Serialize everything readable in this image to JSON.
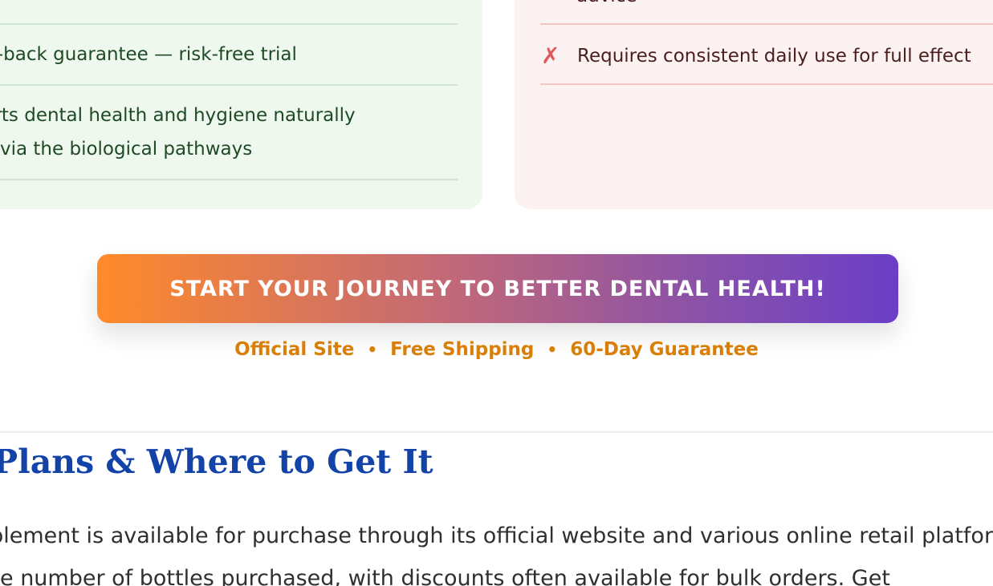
{
  "pros": {
    "items": [
      {
        "label": "Money-back guarantee — risk-free trial"
      },
      {
        "label": "Supports dental health and hygiene naturally",
        "label2": "via the biological pathways"
      }
    ]
  },
  "cons": {
    "partial_top": "advice",
    "items": [
      {
        "icon": "x-mark-icon",
        "label": "Requires consistent daily use for full effect"
      }
    ]
  },
  "cta": {
    "button_label": "START YOUR JOURNEY TO BETTER DENTAL HEALTH!",
    "trust": [
      "Official Site",
      "Free Shipping",
      "60-Day Guarantee"
    ],
    "separator": "•"
  },
  "section": {
    "title": "Pricing Plans & Where to Get It",
    "paragraph_lines": [
      "The supplement is available for purchase through its official website and various online retail platforms",
      "based on the number of bottles purchased, with discounts often available for bulk orders. Get"
    ]
  },
  "colors": {
    "pros_bg": "#eef8ee",
    "cons_bg": "#fdf2f2",
    "title_blue": "#1443a8",
    "trust_orange": "#d97f07",
    "cta_start": "#ff8a2a",
    "cta_end": "#6b3ec8"
  }
}
